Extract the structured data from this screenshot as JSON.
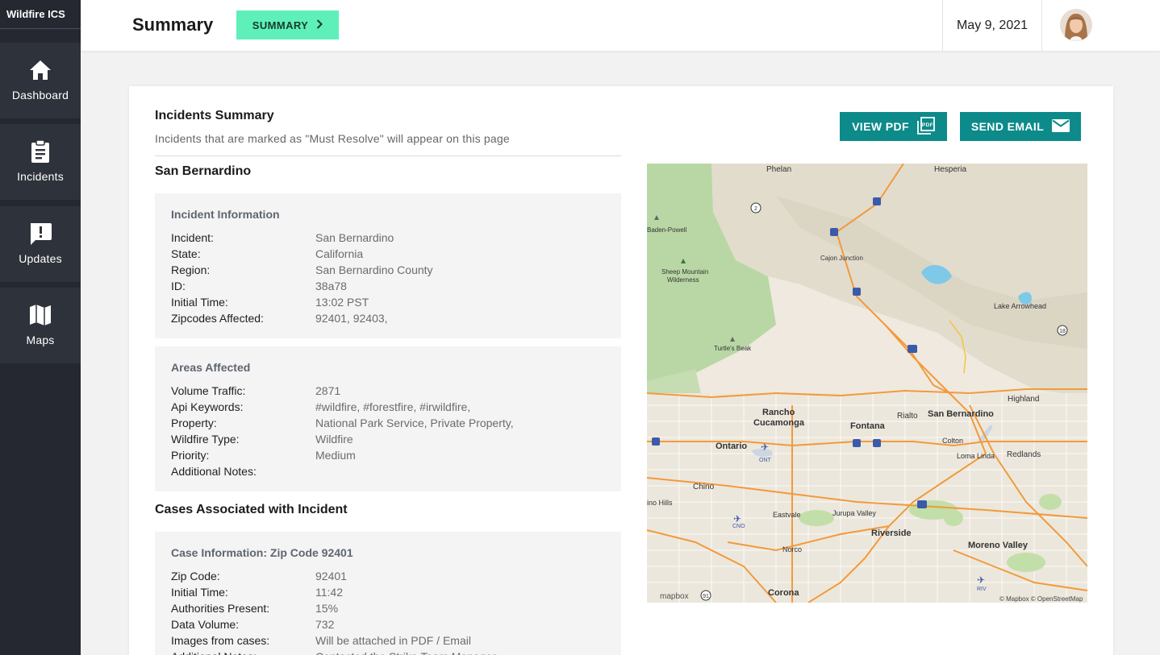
{
  "app": {
    "brand": "Wildfire ICS"
  },
  "sidebar": {
    "items": [
      {
        "label": "Dashboard",
        "icon": "home-icon"
      },
      {
        "label": "Incidents",
        "icon": "clipboard-icon"
      },
      {
        "label": "Updates",
        "icon": "alert-message-icon"
      },
      {
        "label": "Maps",
        "icon": "map-icon"
      }
    ]
  },
  "header": {
    "title": "Summary",
    "summary_button": "SUMMARY",
    "date": "May 9, 2021"
  },
  "card": {
    "title": "Incidents Summary",
    "subtitle": "Incidents that are marked as \"Must Resolve\" will appear on this page",
    "view_pdf": "VIEW PDF",
    "send_email": "SEND EMAIL",
    "location_title": "San Bernardino",
    "incident_info": {
      "title": "Incident Information",
      "rows": [
        {
          "k": "Incident:",
          "v": "San Bernardino"
        },
        {
          "k": "State:",
          "v": "California"
        },
        {
          "k": "Region:",
          "v": "San Bernardino County"
        },
        {
          "k": "ID:",
          "v": "38a78"
        },
        {
          "k": "Initial Time:",
          "v": "13:02 PST"
        },
        {
          "k": "Zipcodes Affected:",
          "v": "92401, 92403,"
        }
      ]
    },
    "areas_affected": {
      "title": "Areas Affected",
      "rows": [
        {
          "k": "Volume Traffic:",
          "v": "2871"
        },
        {
          "k": "Api Keywords:",
          "v": "#wildfire, #forestfire, #irwildfire,"
        },
        {
          "k": "Property:",
          "v": "National Park Service, Private Property,"
        },
        {
          "k": "Wildfire Type:",
          "v": "Wildfire"
        },
        {
          "k": "Priority:",
          "v": "Medium"
        },
        {
          "k": "Additional Notes:",
          "v": ""
        }
      ]
    },
    "cases_title": "Cases Associated with Incident",
    "case_info": {
      "title": "Case Information: Zip Code 92401",
      "rows": [
        {
          "k": "Zip Code:",
          "v": "92401"
        },
        {
          "k": "Initial Time:",
          "v": "11:42"
        },
        {
          "k": "Authorities Present:",
          "v": "15%"
        },
        {
          "k": "Data Volume:",
          "v": "732"
        },
        {
          "k": "Images from cases:",
          "v": "Will be attached in PDF / Email"
        },
        {
          "k": "Additional Notes:",
          "v": "Contacted the Strike Team Manager"
        }
      ]
    }
  },
  "map": {
    "labels": {
      "phelan": "Phelan",
      "hesperia": "Hesperia",
      "baden_powell": "Baden-Powell",
      "cajon_junction": "Cajon Junction",
      "sheep_mountain": "Sheep Mountain",
      "wilderness": "Wilderness",
      "lake_arrowhead": "Lake Arrowhead",
      "turtles_beak": "Turtle's Beak",
      "rancho": "Rancho",
      "cucamonga": "Cucamonga",
      "fontana": "Fontana",
      "rialto": "Rialto",
      "san_bernardino": "San Bernardino",
      "highland": "Highland",
      "ontario": "Ontario",
      "ont": "ONT",
      "colton": "Colton",
      "loma_linda": "Loma Linda",
      "redlands": "Redlands",
      "chino": "Chino",
      "chino_hills": "ino Hills",
      "eastvale": "Eastvale",
      "jurupa_valley": "Jurupa Valley",
      "cno": "CNO",
      "riverside": "Riverside",
      "norco": "Norco",
      "moreno_valley": "Moreno Valley",
      "riv": "RIV",
      "corona": "Corona",
      "mapbox": "mapbox",
      "attribution": "© Mapbox © OpenStreetMap",
      "shield_2": "2",
      "shield_15": "15",
      "shield_18": "18",
      "shield_215": "215",
      "shield_10": "10",
      "shield_91": "91"
    },
    "colors": {
      "terrain": "#efe9df",
      "forest": "#b9d7a4",
      "road": "#f29a3b",
      "water": "#7ec8e8"
    }
  },
  "colors": {
    "sidebar": "#252830",
    "accent_green": "#5ff0b9",
    "teal": "#0d8a8a"
  }
}
